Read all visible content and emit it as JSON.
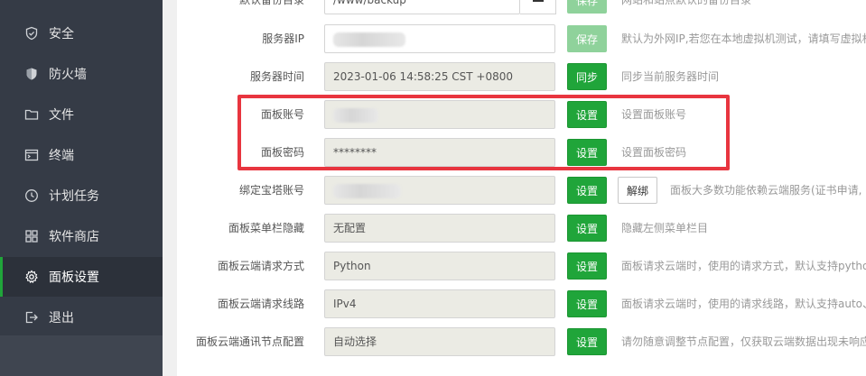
{
  "sidebar": {
    "items": [
      {
        "label": "安全",
        "icon": "shield-outline-icon",
        "active": false
      },
      {
        "label": "防火墙",
        "icon": "shield-filled-icon",
        "active": false
      },
      {
        "label": "文件",
        "icon": "folder-icon",
        "active": false
      },
      {
        "label": "终端",
        "icon": "terminal-icon",
        "active": false
      },
      {
        "label": "计划任务",
        "icon": "clock-icon",
        "active": false
      },
      {
        "label": "软件商店",
        "icon": "grid-icon",
        "active": false
      },
      {
        "label": "面板设置",
        "icon": "gear-icon",
        "active": true
      },
      {
        "label": "退出",
        "icon": "logout-icon",
        "active": false
      }
    ]
  },
  "settings": {
    "backup": {
      "label": "默认备份目录",
      "value": "/www/backup",
      "button": "保存",
      "desc": "网站和站点默认的备份目录"
    },
    "server_ip": {
      "label": "服务器IP",
      "value": "",
      "button": "保存",
      "desc": "默认为外网IP,若您在本地虚拟机测试，请填写虚拟机"
    },
    "server_time": {
      "label": "服务器时间",
      "value": "2023-01-06 14:58:25 CST +0800",
      "button": "同步",
      "desc": "同步当前服务器时间"
    },
    "panel_account": {
      "label": "面板账号",
      "value": "",
      "button": "设置",
      "desc": "设置面板账号"
    },
    "panel_password": {
      "label": "面板密码",
      "value": "********",
      "button": "设置",
      "desc": "设置面板密码"
    },
    "bt_account": {
      "label": "绑定宝塔账号",
      "value": "",
      "button": "设置",
      "button2": "解绑",
      "desc": "面板大多数功能依赖云端服务(证书申请,"
    },
    "menu_hide": {
      "label": "面板菜单栏隐藏",
      "value": "无配置",
      "button": "设置",
      "desc": "隐藏左侧菜单栏目"
    },
    "cloud_method": {
      "label": "面板云端请求方式",
      "value": "Python",
      "button": "设置",
      "desc": "面板请求云端时，使用的请求方式，默认支持pytho"
    },
    "cloud_route": {
      "label": "面板云端请求线路",
      "value": "IPv4",
      "button": "设置",
      "desc": "面板请求云端时，使用的请求线路，默认支持auto、"
    },
    "cloud_node": {
      "label": "面板云端通讯节点配置",
      "value": "自动选择",
      "button": "设置",
      "desc": "请勿随意调整节点配置，仅获取云端数据出现未响应"
    }
  },
  "colors": {
    "accent": "#20a53a",
    "sidebar_bg": "#353b46",
    "highlight": "#e8353f"
  }
}
